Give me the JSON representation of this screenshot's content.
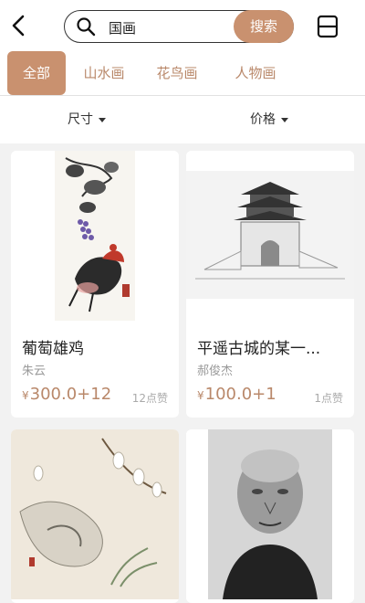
{
  "search": {
    "query": "国画",
    "button_label": "搜索"
  },
  "tabs": [
    {
      "label": "全部",
      "active": true
    },
    {
      "label": "山水画",
      "active": false
    },
    {
      "label": "花鸟画",
      "active": false
    },
    {
      "label": "人物画",
      "active": false
    }
  ],
  "filters": {
    "size_label": "尺寸",
    "price_label": "价格"
  },
  "products": [
    {
      "title": "葡萄雄鸡",
      "author": "朱云",
      "currency": "¥",
      "price": "300.0+12",
      "likes": "12点赞"
    },
    {
      "title": "平遥古城的某一...",
      "author": "郝俊杰",
      "currency": "¥",
      "price": "100.0+1",
      "likes": "1点赞"
    },
    {
      "title": "",
      "author": "",
      "currency": "",
      "price": "",
      "likes": ""
    },
    {
      "title": "",
      "author": "",
      "currency": "",
      "price": "",
      "likes": ""
    }
  ],
  "colors": {
    "accent": "#c9916f",
    "accent_text": "#b9886a"
  }
}
